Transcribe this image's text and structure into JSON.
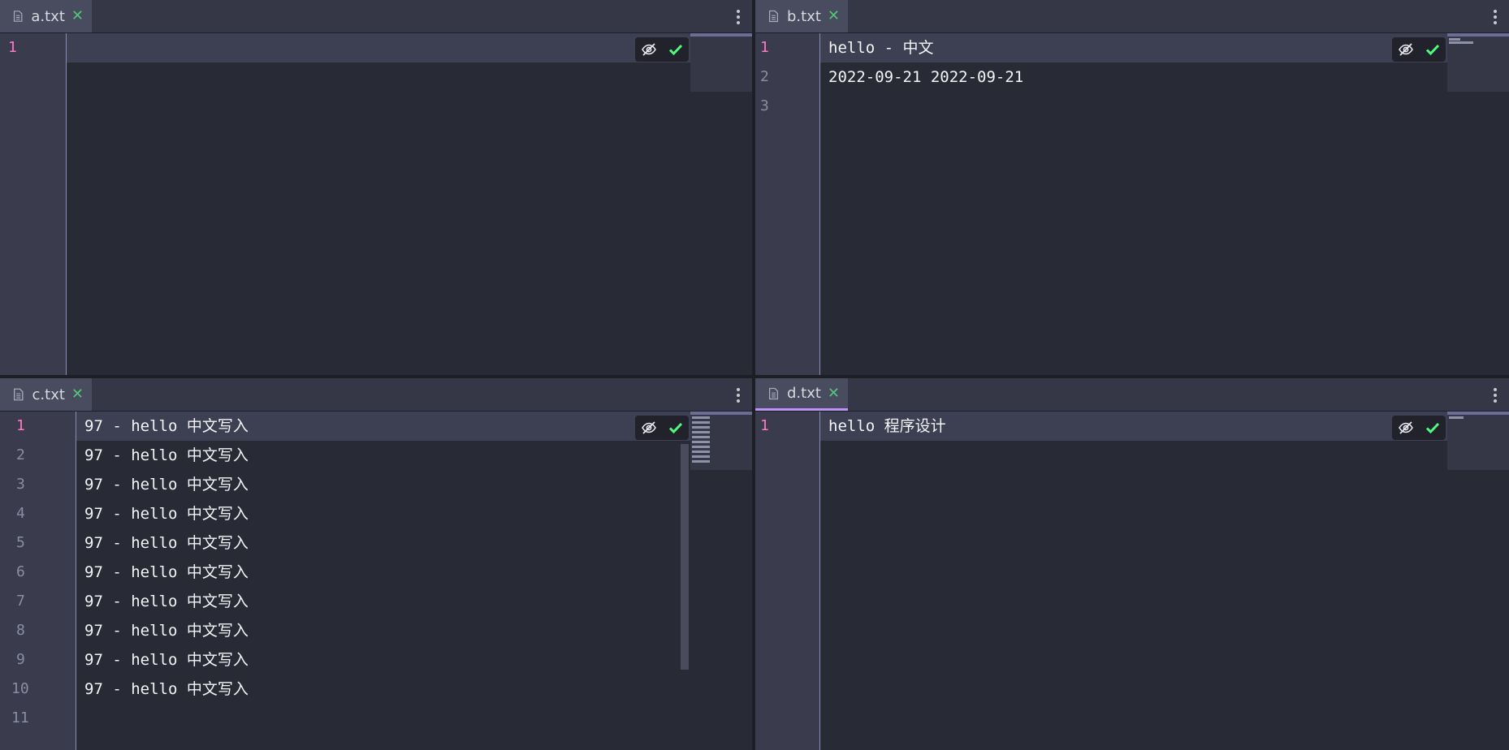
{
  "panes": [
    {
      "tab": {
        "label": "a.txt",
        "close": "✕"
      },
      "lines": [
        ""
      ],
      "line_numbers": [
        "1"
      ]
    },
    {
      "tab": {
        "label": "b.txt",
        "close": "✕"
      },
      "lines": [
        "hello - 中文",
        "2022-09-21 2022-09-21",
        ""
      ],
      "line_numbers": [
        "1",
        "2",
        "3"
      ]
    },
    {
      "tab": {
        "label": "c.txt",
        "close": "✕"
      },
      "lines": [
        "97 - hello 中文写入",
        "97 - hello 中文写入",
        "97 - hello 中文写入",
        "97 - hello 中文写入",
        "97 - hello 中文写入",
        "97 - hello 中文写入",
        "97 - hello 中文写入",
        "97 - hello 中文写入",
        "97 - hello 中文写入",
        "97 - hello 中文写入",
        ""
      ],
      "line_numbers": [
        "1",
        "2",
        "3",
        "4",
        "5",
        "6",
        "7",
        "8",
        "9",
        "10",
        "11"
      ]
    },
    {
      "tab": {
        "label": "d.txt",
        "close": "✕"
      },
      "lines": [
        "hello 程序设计"
      ],
      "line_numbers": [
        "1"
      ]
    }
  ],
  "icons": {
    "file": "file-icon",
    "close": "close-icon",
    "menu": "kebab-menu-icon",
    "hide": "eye-off-icon",
    "check": "check-icon"
  },
  "colors": {
    "accent": "#bd93f9",
    "current_line_number": "#ff79c6",
    "check": "#50fa7b",
    "close": "#50c878"
  }
}
